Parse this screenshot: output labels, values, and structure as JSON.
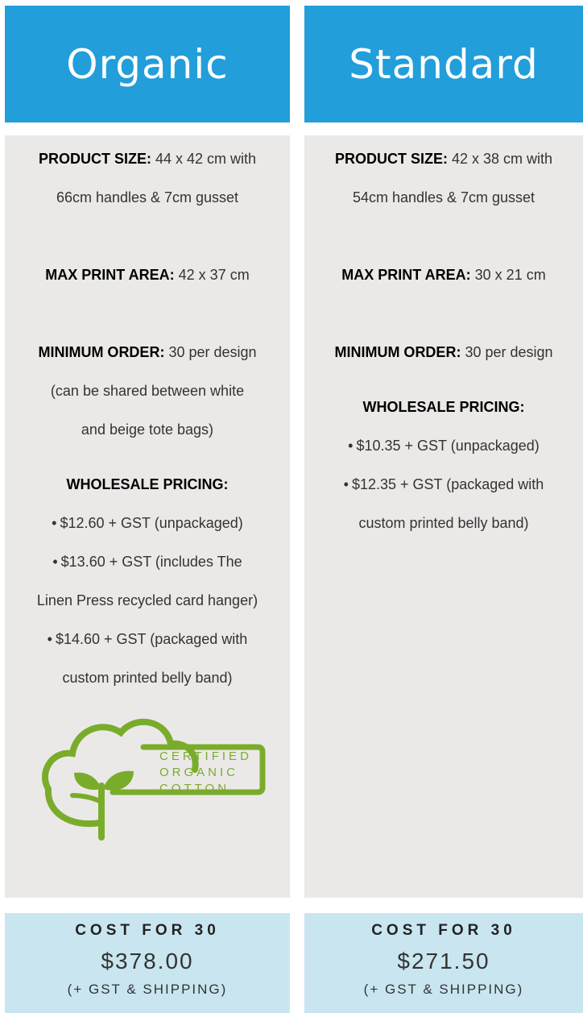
{
  "columns": [
    {
      "title": "Organic",
      "product_size_label": "PRODUCT SIZE:",
      "product_size_line1": "44 x 42 cm with",
      "product_size_line2": "66cm handles & 7cm gusset",
      "max_print_label": "MAX PRINT AREA:",
      "max_print_value": "42 x 37 cm",
      "min_order_label": "MINIMUM ORDER:",
      "min_order_value": "30 per design",
      "min_order_line2": "(can be shared between white",
      "min_order_line3": "and beige tote bags)",
      "pricing_title": "WHOLESALE PRICING:",
      "pricing_lines": [
        "$12.60 + GST (unpackaged)",
        "$13.60 + GST (includes The",
        "Linen Press recycled card hanger)",
        "$14.60 + GST (packaged with",
        "custom printed belly band)"
      ],
      "logo_text": [
        "CERTIFIED",
        "ORGANIC",
        "COTTON"
      ],
      "cost_title": "COST FOR 30",
      "cost_value": "$378.00",
      "cost_note": "(+ GST & SHIPPING)"
    },
    {
      "title": "Standard",
      "product_size_label": "PRODUCT SIZE:",
      "product_size_line1": "42 x 38 cm with",
      "product_size_line2": "54cm handles & 7cm gusset",
      "max_print_label": "MAX PRINT AREA:",
      "max_print_value": "30 x 21 cm",
      "min_order_label": "MINIMUM ORDER:",
      "min_order_value": "30 per design",
      "pricing_title": "WHOLESALE PRICING:",
      "pricing_lines": [
        "$10.35 + GST (unpackaged)",
        "$12.35 + GST (packaged with",
        "custom printed belly band)"
      ],
      "cost_title": "COST FOR 30",
      "cost_value": "$271.50",
      "cost_note": "(+ GST & SHIPPING)"
    }
  ],
  "colors": {
    "header": "#229edb",
    "body": "#ebe9e8",
    "cost": "#c9e6f0",
    "logo_green": "#7aac2b"
  }
}
